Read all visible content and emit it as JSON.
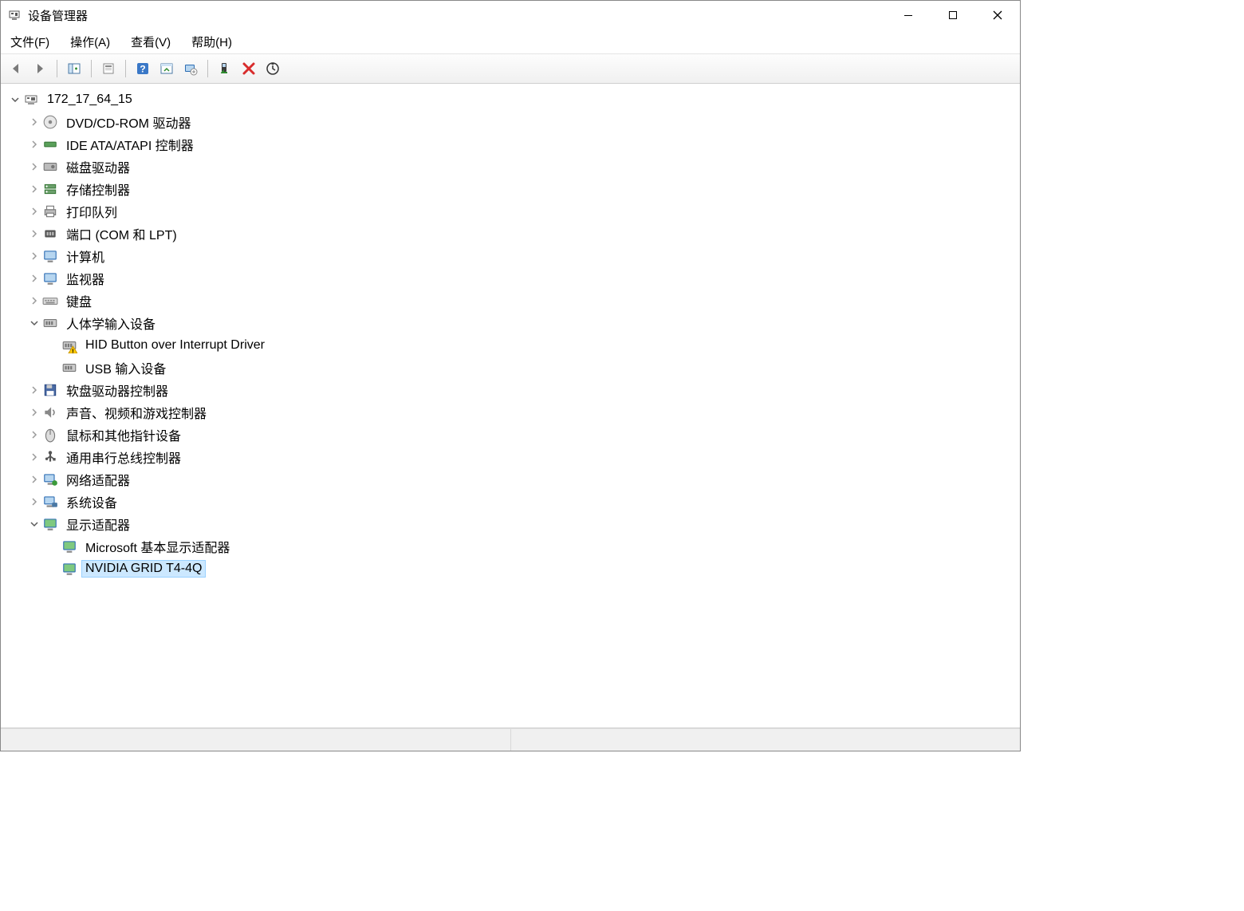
{
  "window": {
    "title": "设备管理器"
  },
  "menu": {
    "file": "文件(F)",
    "action": "操作(A)",
    "view": "查看(V)",
    "help": "帮助(H)"
  },
  "toolbar_icons": {
    "back": "back-icon",
    "forward": "forward-icon",
    "show_hide": "show-hide-icon",
    "properties": "properties-icon",
    "help": "help-icon",
    "scan": "scan-icon",
    "update": "update-icon",
    "enable": "enable-device-icon",
    "delete": "delete-icon",
    "options": "options-icon"
  },
  "tree": {
    "root": {
      "label": "172_17_64_15",
      "expanded": true
    },
    "categories": [
      {
        "label": "DVD/CD-ROM 驱动器",
        "icon": "disc-icon",
        "expanded": false,
        "children": []
      },
      {
        "label": "IDE ATA/ATAPI 控制器",
        "icon": "ide-icon",
        "expanded": false,
        "children": []
      },
      {
        "label": "磁盘驱动器",
        "icon": "disk-icon",
        "expanded": false,
        "children": []
      },
      {
        "label": "存储控制器",
        "icon": "storage-icon",
        "expanded": false,
        "children": []
      },
      {
        "label": "打印队列",
        "icon": "printer-icon",
        "expanded": false,
        "children": []
      },
      {
        "label": "端口 (COM 和 LPT)",
        "icon": "port-icon",
        "expanded": false,
        "children": []
      },
      {
        "label": "计算机",
        "icon": "computer-icon",
        "expanded": false,
        "children": []
      },
      {
        "label": "监视器",
        "icon": "monitor-icon",
        "expanded": false,
        "children": []
      },
      {
        "label": "键盘",
        "icon": "keyboard-icon",
        "expanded": false,
        "children": []
      },
      {
        "label": "人体学输入设备",
        "icon": "hid-icon",
        "expanded": true,
        "children": [
          {
            "label": "HID Button over Interrupt Driver",
            "icon": "hid-warn-icon",
            "warning": true,
            "selected": false
          },
          {
            "label": "USB 输入设备",
            "icon": "hid-icon",
            "selected": false
          }
        ]
      },
      {
        "label": "软盘驱动器控制器",
        "icon": "floppy-icon",
        "expanded": false,
        "children": []
      },
      {
        "label": "声音、视频和游戏控制器",
        "icon": "audio-icon",
        "expanded": false,
        "children": []
      },
      {
        "label": "鼠标和其他指针设备",
        "icon": "mouse-icon",
        "expanded": false,
        "children": []
      },
      {
        "label": "通用串行总线控制器",
        "icon": "usb-icon",
        "expanded": false,
        "children": []
      },
      {
        "label": "网络适配器",
        "icon": "network-icon",
        "expanded": false,
        "children": []
      },
      {
        "label": "系统设备",
        "icon": "system-icon",
        "expanded": false,
        "children": []
      },
      {
        "label": "显示适配器",
        "icon": "display-icon",
        "expanded": true,
        "children": [
          {
            "label": "Microsoft 基本显示适配器",
            "icon": "display-icon",
            "selected": false
          },
          {
            "label": "NVIDIA GRID T4-4Q",
            "icon": "display-icon",
            "selected": true
          }
        ]
      }
    ]
  }
}
